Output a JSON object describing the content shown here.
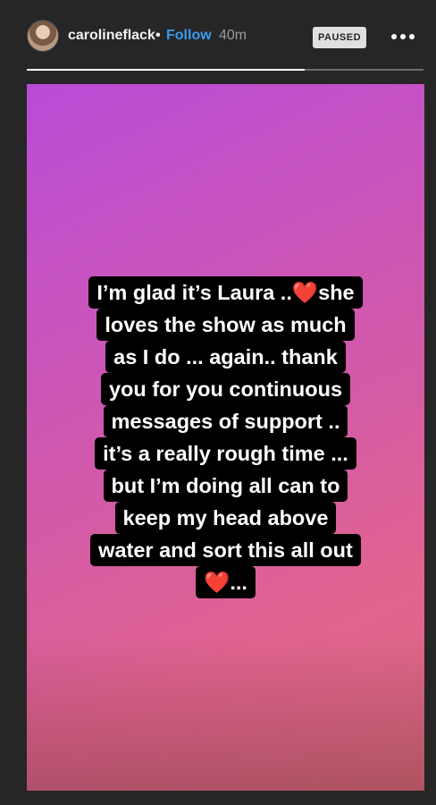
{
  "header": {
    "username": "carolineflack",
    "separator": "•",
    "follow_label": "Follow",
    "time_ago": "40m",
    "status_badge": "PAUSED",
    "more_icon": "more-dots-icon"
  },
  "progress": {
    "fraction": 0.7
  },
  "story": {
    "caption_lines": [
      "I’m glad it’s Laura ..❤️she",
      "loves the show as much",
      "as I do ... again.. thank",
      "you for you continuous",
      "messages of support ..",
      "it’s a really rough time ...",
      "but I’m doing all can to",
      "keep  my head above",
      "water and sort this all out",
      "❤️..."
    ],
    "background_colors": [
      "#b94bd6",
      "#d35aa8",
      "#dc6a80"
    ]
  }
}
